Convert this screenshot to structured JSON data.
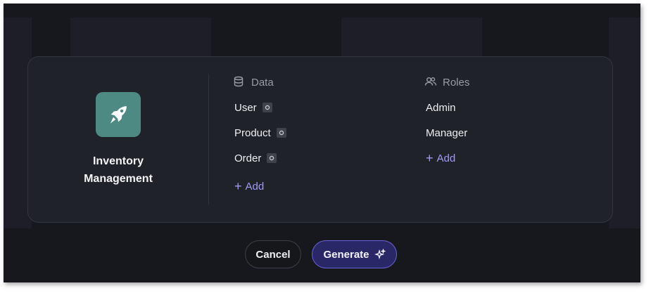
{
  "project": {
    "name_line1": "Inventory",
    "name_line2": "Management"
  },
  "data_section": {
    "title": "Data",
    "items": [
      {
        "label": "User"
      },
      {
        "label": "Product"
      },
      {
        "label": "Order"
      }
    ],
    "add_label": "Add"
  },
  "roles_section": {
    "title": "Roles",
    "items": [
      {
        "label": "Admin"
      },
      {
        "label": "Manager"
      }
    ],
    "add_label": "Add"
  },
  "actions": {
    "cancel_label": "Cancel",
    "generate_label": "Generate"
  },
  "colors": {
    "accent": "#a09cf2",
    "app_icon_bg": "#4e8a84",
    "generate_bg": "#2a2766"
  }
}
